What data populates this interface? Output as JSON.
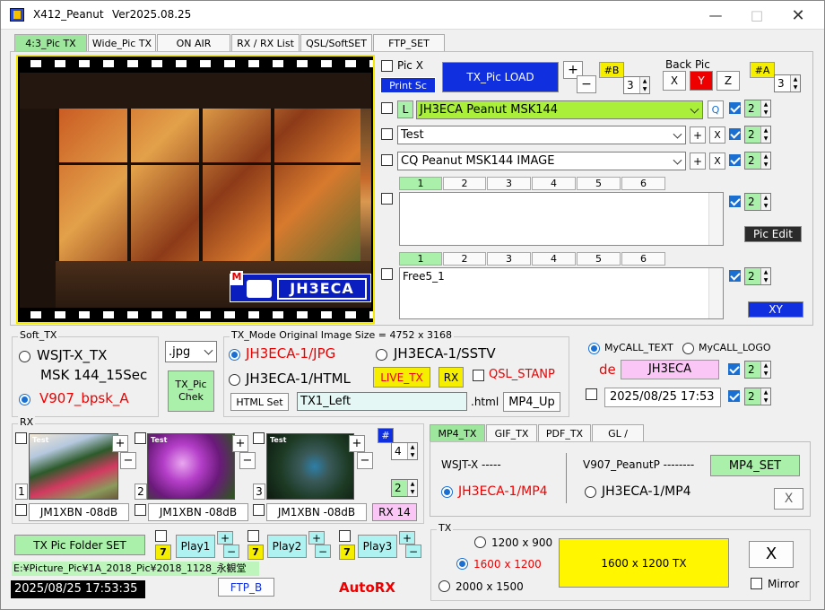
{
  "window": {
    "title": "X412_Peanut",
    "version": "Ver2025.08.25"
  },
  "tabs": [
    "4:3_Pic TX",
    "Wide_Pic TX",
    "ON AIR",
    "RX / RX List",
    "QSL/SoftSET",
    "FTP_SET"
  ],
  "pic": {
    "logo_text": "JH3ECA",
    "logo_badge": "M"
  },
  "controls": {
    "pic_x": "Pic X",
    "print_sc": "Print Sc",
    "tx_pic_load": "TX_Pic  LOAD",
    "plus": "+",
    "minus": "−",
    "b_badge": "#B",
    "b_value": "3",
    "back_pic": "Back Pic",
    "x": "X",
    "y": "Y",
    "z": "Z",
    "a_badge": "#A",
    "a_value": "3"
  },
  "lines": [
    {
      "l": "L",
      "text": "JH3ECA  Peanut  MSK144",
      "q": "Q",
      "size": "2"
    },
    {
      "text": "Test",
      "size": "2"
    },
    {
      "text": "CQ Peanut MSK144 IMAGE",
      "size": "2"
    }
  ],
  "free1": {
    "tabs": [
      "1",
      "2",
      "3",
      "4",
      "5",
      "6"
    ],
    "text": "",
    "size": "2",
    "pic_edit": "Pic  Edit"
  },
  "free2": {
    "tabs": [
      "1",
      "2",
      "3",
      "4",
      "5",
      "6"
    ],
    "text": "Free5_1",
    "size": "2",
    "xy": "XY"
  },
  "soft_tx": {
    "title": "Soft_TX",
    "opt1": "WSJT-X_TX",
    "opt1b": "MSK 144_15Sec",
    "opt2": "V907_bpsk_A"
  },
  "format": {
    "value": ".jpg",
    "chek": "TX_Pic\nChek"
  },
  "tx_mode": {
    "title": "TX_Mode  Original  Image  Size = 4752 x 3168",
    "opt1": "JH3ECA-1/JPG",
    "opt2": "JH3ECA-1/SSTV",
    "opt3": "JH3ECA-1/HTML",
    "live_tx": "LIVE_TX",
    "rx": "RX",
    "qsl_stanp": "QSL_STANP",
    "html_set": "HTML Set",
    "html_name": "TX1_Left",
    "html_ext": ".html",
    "mp4_up": "MP4_Up"
  },
  "mycall": {
    "opt1": "MyCALL_TEXT",
    "opt2": "MyCALL_LOGO",
    "de": "de",
    "call": "JH3ECA",
    "size1": "2",
    "datetime": "2025/08/25  17:53",
    "size2": "2"
  },
  "rx": {
    "title": "RX",
    "hash": "#",
    "n1": "4",
    "n2": "2",
    "rx_button": "RX 14",
    "items": [
      {
        "num": "1",
        "label": "JM1XBN  -08dB",
        "tag": "Test"
      },
      {
        "num": "2",
        "label": "JM1XBN  -08dB",
        "tag": "Test"
      },
      {
        "num": "3",
        "label": "JM1XBN  -08dB",
        "tag": "Test"
      }
    ]
  },
  "media_tabs": [
    "MP4_TX",
    "GIF_TX",
    "PDF_TX",
    "GL /"
  ],
  "media": {
    "wsjt_label": "WSJT-X  -----",
    "wsjt_opt": "JH3ECA-1/MP4",
    "v907_label": "V907_PeanutP  --------",
    "v907_opt": "JH3ECA-1/MP4",
    "mp4_set": "MP4_SET",
    "close": "X"
  },
  "folder": {
    "set": "TX Pic  Folder SET",
    "play1": "Play1",
    "play2": "Play2",
    "play3": "Play3",
    "seven": "7",
    "path": "E:¥Picture_Pic¥1A_2018_Pic¥2018_1128_永観堂"
  },
  "status": {
    "clock": "2025/08/25   17:53:35",
    "ftp_b": "FTP_B",
    "autorx": "AutoRX"
  },
  "tx": {
    "title": "TX",
    "opt1": "1200 x 900",
    "opt2": "1600 x 1200",
    "opt3": "2000 x 1500",
    "tx_button": "1600 x 1200   TX",
    "x": "X",
    "mirror": "Mirror"
  }
}
